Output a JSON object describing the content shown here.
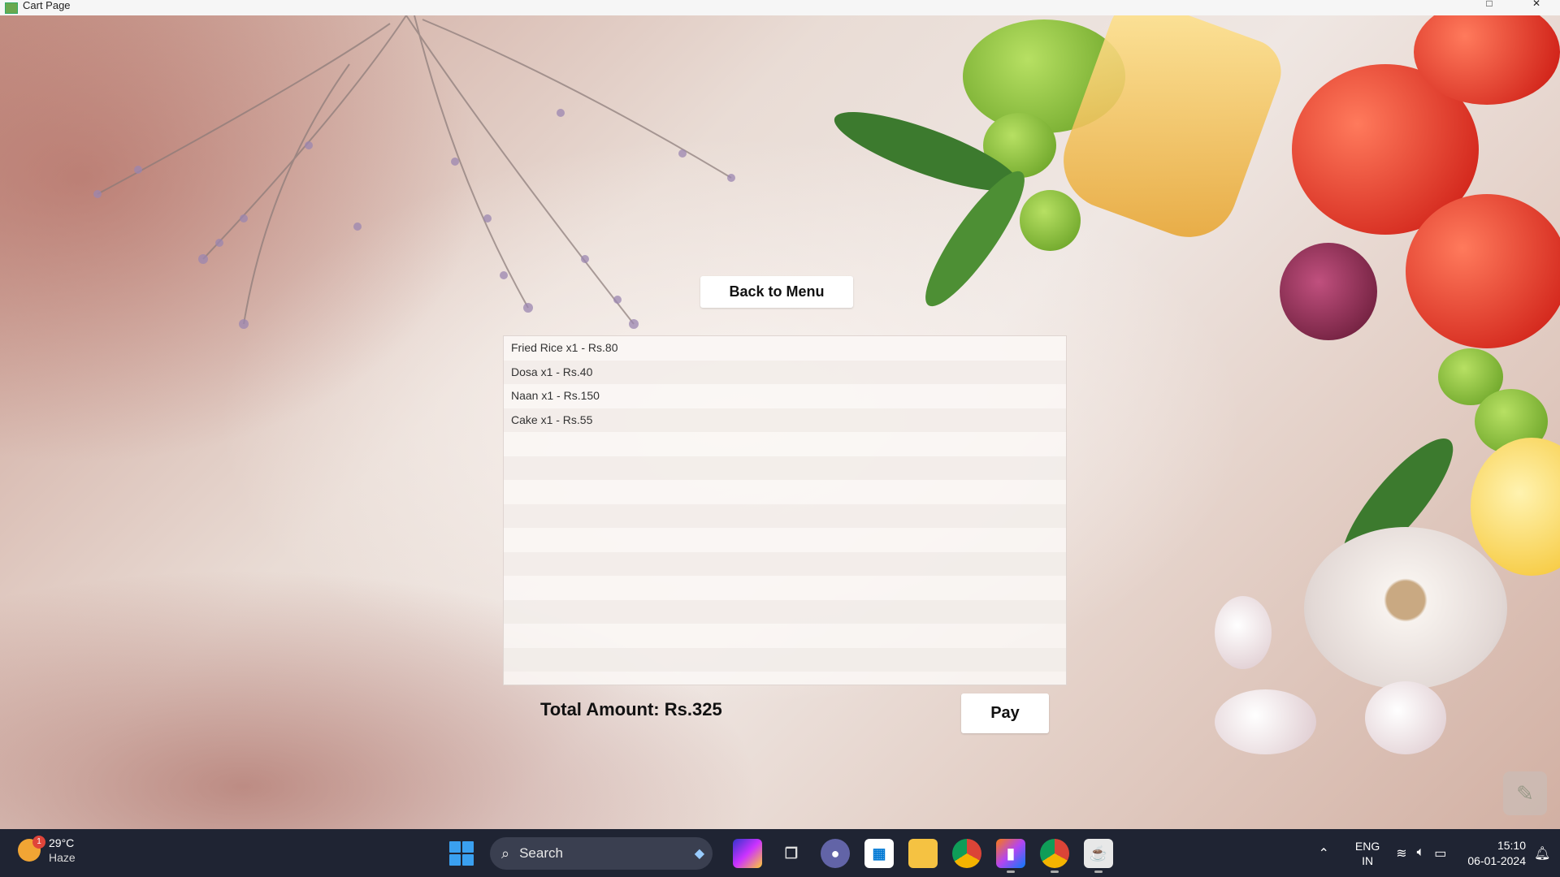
{
  "window": {
    "title": "Cart Page",
    "controls": {
      "maximize_icon": "maximize-icon",
      "close_icon": "close-icon"
    }
  },
  "cart": {
    "back_button": "Back to Menu",
    "items": [
      "Fried Rice x1 - Rs.80",
      "Dosa x1 - Rs.40",
      "Naan x1 - Rs.150",
      "Cake x1 - Rs.55"
    ],
    "total_text": "Total Amount: Rs.325",
    "pay_button": "Pay"
  },
  "taskbar": {
    "weather": {
      "temp": "29°C",
      "condition": "Haze",
      "badge": "1"
    },
    "search_placeholder": "Search",
    "apps": [
      "copilot",
      "task-view",
      "teams",
      "microsoft-store",
      "file-explorer",
      "chrome",
      "intellij",
      "chrome-profile",
      "java"
    ],
    "language": {
      "line1": "ENG",
      "line2": "IN"
    },
    "clock": {
      "time": "15:10",
      "date": "06-01-2024"
    }
  },
  "colors": {
    "taskbar_bg": "#1f2433",
    "button_bg": "#ffffff",
    "list_bg": "#faf7f5"
  }
}
